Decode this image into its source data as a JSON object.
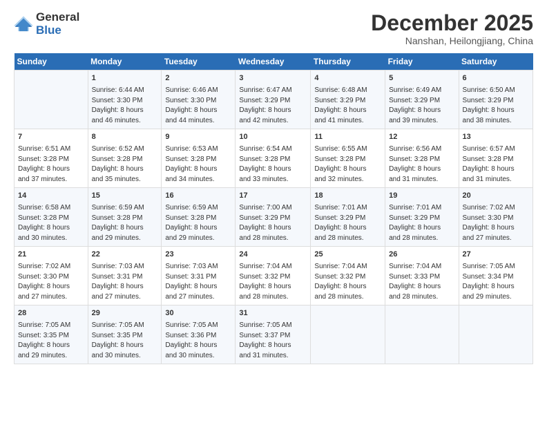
{
  "logo": {
    "line1": "General",
    "line2": "Blue"
  },
  "title": "December 2025",
  "subtitle": "Nanshan, Heilongjiang, China",
  "days_of_week": [
    "Sunday",
    "Monday",
    "Tuesday",
    "Wednesday",
    "Thursday",
    "Friday",
    "Saturday"
  ],
  "weeks": [
    [
      {
        "day": "",
        "info": ""
      },
      {
        "day": "1",
        "info": "Sunrise: 6:44 AM\nSunset: 3:30 PM\nDaylight: 8 hours\nand 46 minutes."
      },
      {
        "day": "2",
        "info": "Sunrise: 6:46 AM\nSunset: 3:30 PM\nDaylight: 8 hours\nand 44 minutes."
      },
      {
        "day": "3",
        "info": "Sunrise: 6:47 AM\nSunset: 3:29 PM\nDaylight: 8 hours\nand 42 minutes."
      },
      {
        "day": "4",
        "info": "Sunrise: 6:48 AM\nSunset: 3:29 PM\nDaylight: 8 hours\nand 41 minutes."
      },
      {
        "day": "5",
        "info": "Sunrise: 6:49 AM\nSunset: 3:29 PM\nDaylight: 8 hours\nand 39 minutes."
      },
      {
        "day": "6",
        "info": "Sunrise: 6:50 AM\nSunset: 3:29 PM\nDaylight: 8 hours\nand 38 minutes."
      }
    ],
    [
      {
        "day": "7",
        "info": "Sunrise: 6:51 AM\nSunset: 3:28 PM\nDaylight: 8 hours\nand 37 minutes."
      },
      {
        "day": "8",
        "info": "Sunrise: 6:52 AM\nSunset: 3:28 PM\nDaylight: 8 hours\nand 35 minutes."
      },
      {
        "day": "9",
        "info": "Sunrise: 6:53 AM\nSunset: 3:28 PM\nDaylight: 8 hours\nand 34 minutes."
      },
      {
        "day": "10",
        "info": "Sunrise: 6:54 AM\nSunset: 3:28 PM\nDaylight: 8 hours\nand 33 minutes."
      },
      {
        "day": "11",
        "info": "Sunrise: 6:55 AM\nSunset: 3:28 PM\nDaylight: 8 hours\nand 32 minutes."
      },
      {
        "day": "12",
        "info": "Sunrise: 6:56 AM\nSunset: 3:28 PM\nDaylight: 8 hours\nand 31 minutes."
      },
      {
        "day": "13",
        "info": "Sunrise: 6:57 AM\nSunset: 3:28 PM\nDaylight: 8 hours\nand 31 minutes."
      }
    ],
    [
      {
        "day": "14",
        "info": "Sunrise: 6:58 AM\nSunset: 3:28 PM\nDaylight: 8 hours\nand 30 minutes."
      },
      {
        "day": "15",
        "info": "Sunrise: 6:59 AM\nSunset: 3:28 PM\nDaylight: 8 hours\nand 29 minutes."
      },
      {
        "day": "16",
        "info": "Sunrise: 6:59 AM\nSunset: 3:28 PM\nDaylight: 8 hours\nand 29 minutes."
      },
      {
        "day": "17",
        "info": "Sunrise: 7:00 AM\nSunset: 3:29 PM\nDaylight: 8 hours\nand 28 minutes."
      },
      {
        "day": "18",
        "info": "Sunrise: 7:01 AM\nSunset: 3:29 PM\nDaylight: 8 hours\nand 28 minutes."
      },
      {
        "day": "19",
        "info": "Sunrise: 7:01 AM\nSunset: 3:29 PM\nDaylight: 8 hours\nand 28 minutes."
      },
      {
        "day": "20",
        "info": "Sunrise: 7:02 AM\nSunset: 3:30 PM\nDaylight: 8 hours\nand 27 minutes."
      }
    ],
    [
      {
        "day": "21",
        "info": "Sunrise: 7:02 AM\nSunset: 3:30 PM\nDaylight: 8 hours\nand 27 minutes."
      },
      {
        "day": "22",
        "info": "Sunrise: 7:03 AM\nSunset: 3:31 PM\nDaylight: 8 hours\nand 27 minutes."
      },
      {
        "day": "23",
        "info": "Sunrise: 7:03 AM\nSunset: 3:31 PM\nDaylight: 8 hours\nand 27 minutes."
      },
      {
        "day": "24",
        "info": "Sunrise: 7:04 AM\nSunset: 3:32 PM\nDaylight: 8 hours\nand 28 minutes."
      },
      {
        "day": "25",
        "info": "Sunrise: 7:04 AM\nSunset: 3:32 PM\nDaylight: 8 hours\nand 28 minutes."
      },
      {
        "day": "26",
        "info": "Sunrise: 7:04 AM\nSunset: 3:33 PM\nDaylight: 8 hours\nand 28 minutes."
      },
      {
        "day": "27",
        "info": "Sunrise: 7:05 AM\nSunset: 3:34 PM\nDaylight: 8 hours\nand 29 minutes."
      }
    ],
    [
      {
        "day": "28",
        "info": "Sunrise: 7:05 AM\nSunset: 3:35 PM\nDaylight: 8 hours\nand 29 minutes."
      },
      {
        "day": "29",
        "info": "Sunrise: 7:05 AM\nSunset: 3:35 PM\nDaylight: 8 hours\nand 30 minutes."
      },
      {
        "day": "30",
        "info": "Sunrise: 7:05 AM\nSunset: 3:36 PM\nDaylight: 8 hours\nand 30 minutes."
      },
      {
        "day": "31",
        "info": "Sunrise: 7:05 AM\nSunset: 3:37 PM\nDaylight: 8 hours\nand 31 minutes."
      },
      {
        "day": "",
        "info": ""
      },
      {
        "day": "",
        "info": ""
      },
      {
        "day": "",
        "info": ""
      }
    ]
  ]
}
